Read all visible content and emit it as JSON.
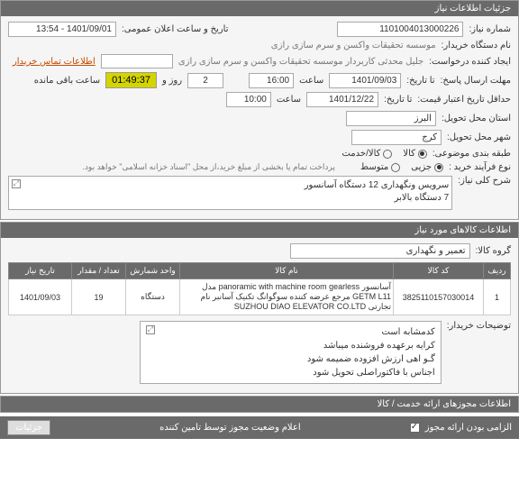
{
  "panel1": {
    "title": "جزئیات اطلاعات نیاز",
    "need_no_label": "شماره نیاز:",
    "need_no": "1101004013000226",
    "date_label": "تاریخ و ساعت اعلان عمومی:",
    "date": "1401/09/01 - 13:54",
    "buyer_label": "نام دستگاه خریدار:",
    "buyer": "موسسه تحقیقات واکسن و سرم سازی رازی",
    "requester_label": "ایجاد کننده درخواست:",
    "requester": "جلیل محدثی کاربردار موسسه تحقیقات واکسن و سرم سازی رازی",
    "contact_link": "اطلاعات تماس خریدار",
    "deadline_label": "مهلت ارسال پاسخ:",
    "deadline_ta": "تا تاریخ:",
    "deadline_date": "1401/09/03",
    "deadline_time_label": "ساعت",
    "deadline_time": "16:00",
    "days_and": "روز و",
    "days": "2",
    "remain_label": "ساعت باقی مانده",
    "remain": "01:49:37",
    "credit_label": "حداقل تاریخ اعتبار قیمت:",
    "credit_ta": "تا تاریخ:",
    "credit_date": "1401/12/22",
    "credit_time": "10:00",
    "province_label": "استان محل تحویل:",
    "province": "البرز",
    "city_label": "شهر محل تحویل:",
    "city": "کرج",
    "category_label": "طبقه بندی موضوعی:",
    "cat_kala": "کالا",
    "cat_service": "کالا/خدمت",
    "buy_type_label": "نوع فرآیند خرید :",
    "buy_jozei": "جزیی",
    "buy_motavaset": "متوسط",
    "pay_note": "پرداخت تمام یا بخشی از مبلغ خرید،از محل \"اسناد خزانه اسلامی\" خواهد بود."
  },
  "desc": {
    "label": "شرح کلی نیاز:",
    "text": "سرویس ونگهداری 12 دستگاه آسانسور\n7 دستگاه بالابر"
  },
  "items": {
    "title": "اطلاعات کالاهای مورد نیاز",
    "group_label": "گروه کالا:",
    "group": "تعمیر و نگهداری",
    "headers": {
      "row": "ردیف",
      "code": "کد کالا",
      "name": "نام کالا",
      "unit": "واحد شمارش",
      "qty": "تعداد / مقدار",
      "need_date": "تاریخ نیاز"
    },
    "rows": [
      {
        "row": "1",
        "code": "3825110157030014",
        "name": "آسانسور panoramic with machine room gearless مدل GETM L11 مرجع عرضه کننده سوگوانگ تکنیک آسانبر نام تجارتی SUZHOU DIAO ELEVATOR CO.LTD",
        "unit": "دستگاه",
        "qty": "19",
        "need_date": "1401/09/03"
      }
    ],
    "buyer_notes_label": "توضیحات خریدار:",
    "buyer_notes": "کدمشابه است\nکرایه برعهده فروشنده میباشد\nگـو اهی ارزش افزوده ضمیمه شود\nاجناس با فاکتوراصلی تحویل شود"
  },
  "permits": {
    "title": "اطلاعات مجوزهای ارائه خدمت / کالا"
  },
  "footer": {
    "mandatory_label": "الزامی بودن ارائه مجوز",
    "confirm_label": "اعلام وضعیت مجوز توسط تامین کننده",
    "details": "جزئیات"
  }
}
